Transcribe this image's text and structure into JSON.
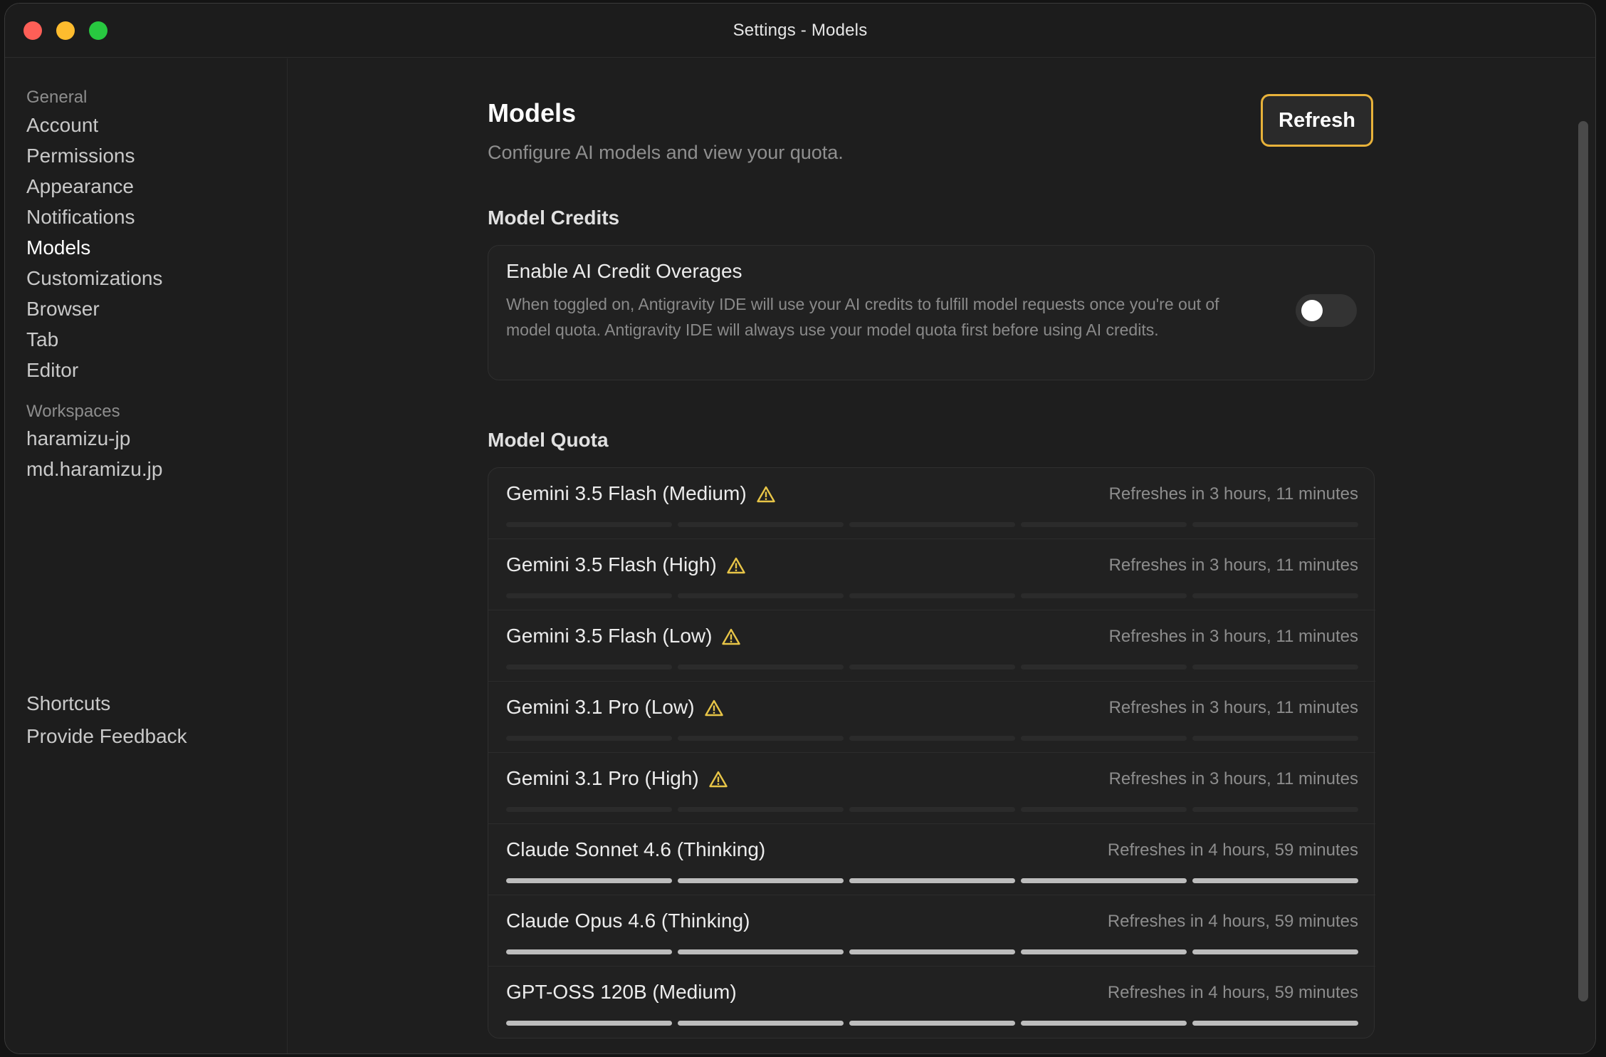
{
  "window": {
    "title": "Settings - Models"
  },
  "sidebar": {
    "general_label": "General",
    "general_items": [
      {
        "label": "Account"
      },
      {
        "label": "Permissions"
      },
      {
        "label": "Appearance"
      },
      {
        "label": "Notifications"
      },
      {
        "label": "Models",
        "active": true
      },
      {
        "label": "Customizations"
      },
      {
        "label": "Browser"
      },
      {
        "label": "Tab"
      },
      {
        "label": "Editor"
      }
    ],
    "workspaces_label": "Workspaces",
    "workspace_items": [
      {
        "label": "haramizu-jp"
      },
      {
        "label": "md.haramizu.jp"
      }
    ],
    "bottom_items": [
      {
        "label": "Shortcuts"
      },
      {
        "label": "Provide Feedback"
      }
    ]
  },
  "header": {
    "title": "Models",
    "subtitle": "Configure AI models and view your quota.",
    "refresh_label": "Refresh"
  },
  "credits": {
    "heading": "Model Credits",
    "title": "Enable AI Credit Overages",
    "description": "When toggled on, Antigravity IDE will use your AI credits to fulfill model requests once you're out of model quota. Antigravity IDE will always use your model quota first before using AI credits.",
    "enabled": false
  },
  "quota": {
    "heading": "Model Quota",
    "models": [
      {
        "name": "Gemini 3.5 Flash (Medium)",
        "warning": true,
        "refresh": "Refreshes in 3 hours, 11 minutes",
        "remaining_segments": 0,
        "total_segments": 5
      },
      {
        "name": "Gemini 3.5 Flash (High)",
        "warning": true,
        "refresh": "Refreshes in 3 hours, 11 minutes",
        "remaining_segments": 0,
        "total_segments": 5
      },
      {
        "name": "Gemini 3.5 Flash (Low)",
        "warning": true,
        "refresh": "Refreshes in 3 hours, 11 minutes",
        "remaining_segments": 0,
        "total_segments": 5
      },
      {
        "name": "Gemini 3.1 Pro (Low)",
        "warning": true,
        "refresh": "Refreshes in 3 hours, 11 minutes",
        "remaining_segments": 0,
        "total_segments": 5
      },
      {
        "name": "Gemini 3.1 Pro (High)",
        "warning": true,
        "refresh": "Refreshes in 3 hours, 11 minutes",
        "remaining_segments": 0,
        "total_segments": 5
      },
      {
        "name": "Claude Sonnet 4.6 (Thinking)",
        "warning": false,
        "refresh": "Refreshes in 4 hours, 59 minutes",
        "remaining_segments": 5,
        "total_segments": 5
      },
      {
        "name": "Claude Opus 4.6 (Thinking)",
        "warning": false,
        "refresh": "Refreshes in 4 hours, 59 minutes",
        "remaining_segments": 5,
        "total_segments": 5
      },
      {
        "name": "GPT-OSS 120B (Medium)",
        "warning": false,
        "refresh": "Refreshes in 4 hours, 59 minutes",
        "remaining_segments": 5,
        "total_segments": 5
      }
    ]
  },
  "colors": {
    "accent_focus": "#e8b23a",
    "warning": "#e8c547"
  },
  "icons": {
    "warning": "warning-triangle-icon"
  }
}
